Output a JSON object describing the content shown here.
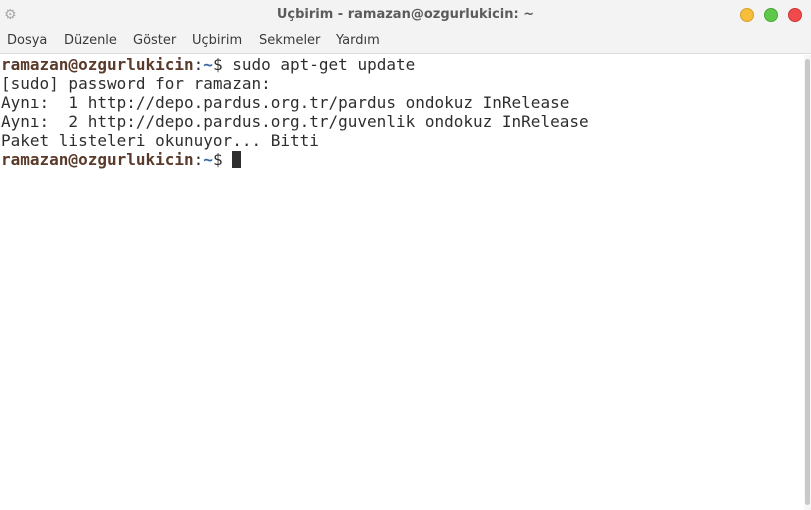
{
  "window": {
    "title": "Uçbirim - ramazan@ozgurlukicin: ~",
    "icon": "gear-icon"
  },
  "menu": {
    "items": [
      "Dosya",
      "Düzenle",
      "Göster",
      "Uçbirim",
      "Sekmeler",
      "Yardım"
    ]
  },
  "terminal": {
    "prompt1": {
      "user": "ramazan@ozgurlukicin",
      "sep": ":",
      "path": "~",
      "symbol": "$",
      "command": " sudo apt-get update"
    },
    "output": [
      "[sudo] password for ramazan:",
      "Aynı:  1 http://depo.pardus.org.tr/pardus ondokuz InRelease",
      "Aynı:  2 http://depo.pardus.org.tr/guvenlik ondokuz InRelease",
      "Paket listeleri okunuyor... Bitti"
    ],
    "prompt2": {
      "user": "ramazan@ozgurlukicin",
      "sep": ":",
      "path": "~",
      "symbol": "$",
      "command": " "
    }
  },
  "colors": {
    "prompt_user": "#5a3a2a",
    "prompt_path": "#3465a4",
    "minimize": "#f6be3a",
    "maximize": "#5fc84a",
    "close": "#f04a4a"
  }
}
